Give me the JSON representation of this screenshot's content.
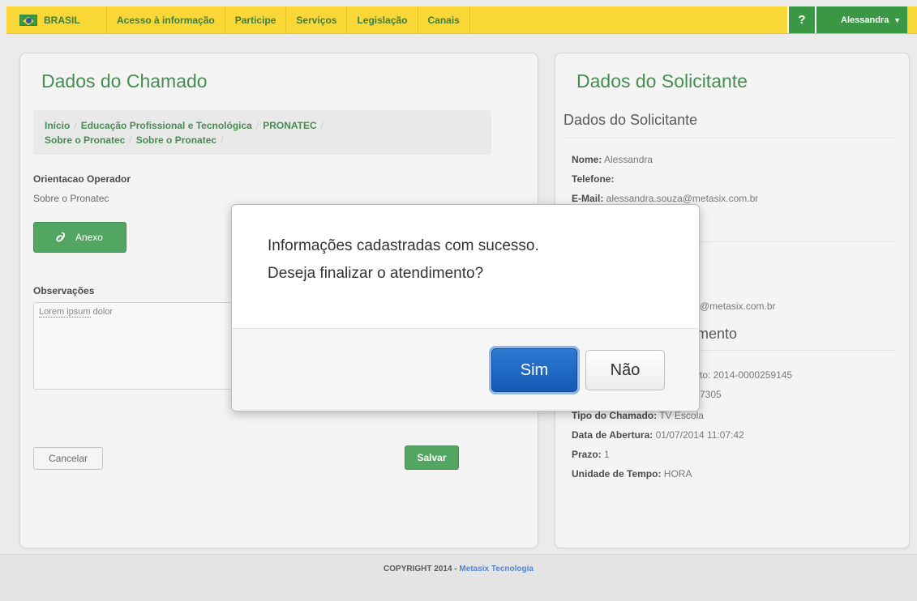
{
  "topbar": {
    "brand": "BRASIL",
    "links": [
      "Acesso à informação",
      "Participe",
      "Serviços",
      "Legislação",
      "Canais"
    ],
    "help_label": "?",
    "user_name": "Alessandra",
    "flag_icon": "brazil-flag-icon",
    "accent": "#f7d21c",
    "green": "#1f8a2c"
  },
  "left": {
    "title": "Dados do Chamado",
    "breadcrumb": [
      "Início",
      "Educação Profissional e Tecnológica",
      "PRONATEC",
      "Sobre o Pronatec",
      "Sobre o Pronatec"
    ],
    "orientacao_label": "Orientacao Operador",
    "orientacao_value": "Sobre o Pronatec",
    "anexo_label": "Anexo",
    "observacoes_label": "Observações",
    "observacoes_value_err": "Lorem ipsum",
    "observacoes_value_rest": " dolor",
    "cancel_label": "Cancelar",
    "save_label": "Salvar"
  },
  "right": {
    "title": "Dados do Solicitante",
    "section1": "Dados do Solicitante",
    "nome_label": "Nome:",
    "nome_value": " Alessandra",
    "telefone_label": "Telefone:",
    "email_label": "E-Mail:",
    "email_value": " alessandra.souza@metasix.com.br",
    "email2_partial": "@metasix.com.br",
    "section2_partial": "mento",
    "protocolo_partial": "to: 2014-0000259145",
    "numero_partial": "7305",
    "tipo_label": "Tipo do Chamado:",
    "tipo_value": " TV Escola",
    "abertura_label": "Data de Abertura:",
    "abertura_value": " 01/07/2014 11:07:42",
    "prazo_label": "Prazo:",
    "prazo_value": " 1",
    "unidade_label": "Unidade de Tempo:",
    "unidade_value": " HORA"
  },
  "modal": {
    "line1": "Informações cadastradas com sucesso.",
    "line2": "Deseja finalizar o atendimento?",
    "yes_label": "Sim",
    "no_label": "Não"
  },
  "footer": {
    "copyright": "COPYRIGHT 2014 - ",
    "company": "Metasix Tecnologia"
  }
}
